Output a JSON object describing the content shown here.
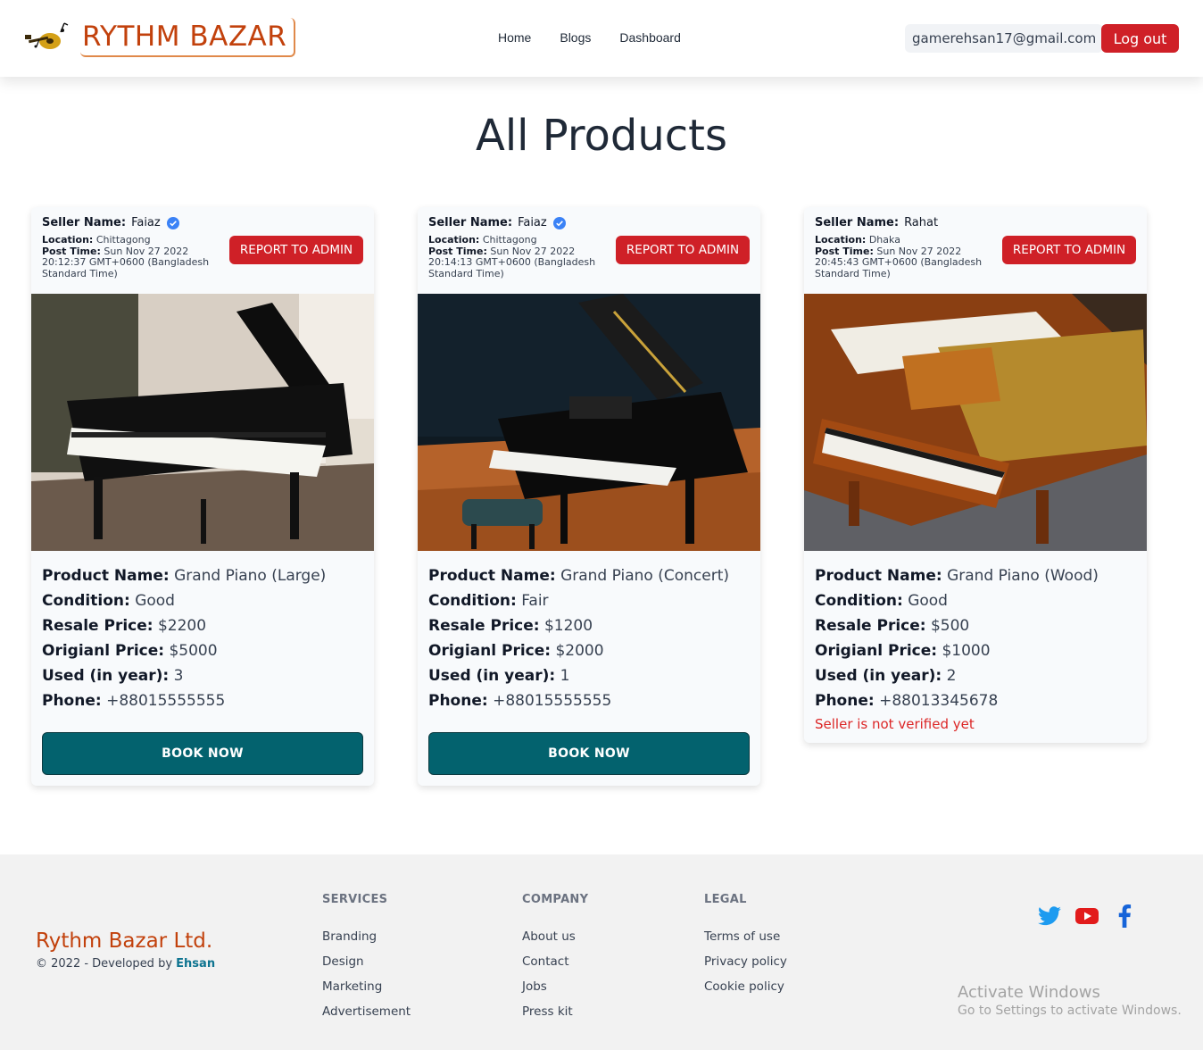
{
  "navbar": {
    "brand": "RYTHM BAZAR",
    "links": [
      "Home",
      "Blogs",
      "Dashboard"
    ],
    "user_email": "gamerehsan17@gmail.com",
    "logout_label": "Log out"
  },
  "page_title": "All Products",
  "labels": {
    "seller_name": "Seller Name:",
    "location": "Location:",
    "post_time": "Post Time:",
    "report": "REPORT TO ADMIN",
    "product_name": "Product Name:",
    "condition": "Condition:",
    "resale_price": "Resale Price:",
    "original_price": "Origianl Price:",
    "used": "Used (in year):",
    "phone": "Phone:",
    "book": "BOOK NOW",
    "not_verified": "Seller is not verified yet"
  },
  "products": [
    {
      "seller": "Faiaz",
      "verified": true,
      "location": "Chittagong",
      "post_time": "Sun Nov 27 2022 20:12:37 GMT+0600 (Bangladesh Standard Time)",
      "name": "Grand Piano (Large)",
      "condition": "Good",
      "resale_price": "$2200",
      "original_price": "$5000",
      "used": "3",
      "phone": "+88015555555"
    },
    {
      "seller": "Faiaz",
      "verified": true,
      "location": "Chittagong",
      "post_time": "Sun Nov 27 2022 20:14:13 GMT+0600 (Bangladesh Standard Time)",
      "name": "Grand Piano (Concert)",
      "condition": "Fair",
      "resale_price": "$1200",
      "original_price": "$2000",
      "used": "1",
      "phone": "+88015555555"
    },
    {
      "seller": "Rahat",
      "verified": false,
      "location": "Dhaka",
      "post_time": "Sun Nov 27 2022 20:45:43 GMT+0600 (Bangladesh Standard Time)",
      "name": "Grand Piano (Wood)",
      "condition": "Good",
      "resale_price": "$500",
      "original_price": "$1000",
      "used": "2",
      "phone": "+88013345678"
    }
  ],
  "footer": {
    "brand": "Rythm Bazar Ltd.",
    "copyright": "© 2022 - Developed by",
    "developer": "Ehsan",
    "services": {
      "title": "SERVICES",
      "items": [
        "Branding",
        "Design",
        "Marketing",
        "Advertisement"
      ]
    },
    "company": {
      "title": "COMPANY",
      "items": [
        "About us",
        "Contact",
        "Jobs",
        "Press kit"
      ]
    },
    "legal": {
      "title": "LEGAL",
      "items": [
        "Terms of use",
        "Privacy policy",
        "Cookie policy"
      ]
    },
    "socials": [
      "twitter-icon",
      "youtube-icon",
      "facebook-icon"
    ]
  },
  "watermark": {
    "title": "Activate Windows",
    "subtitle": "Go to Settings to activate Windows."
  },
  "colors": {
    "accent_red": "#cf2027",
    "brand_orange": "#c2410c",
    "book_teal": "#03626e",
    "verified_blue": "#3b82f6"
  }
}
